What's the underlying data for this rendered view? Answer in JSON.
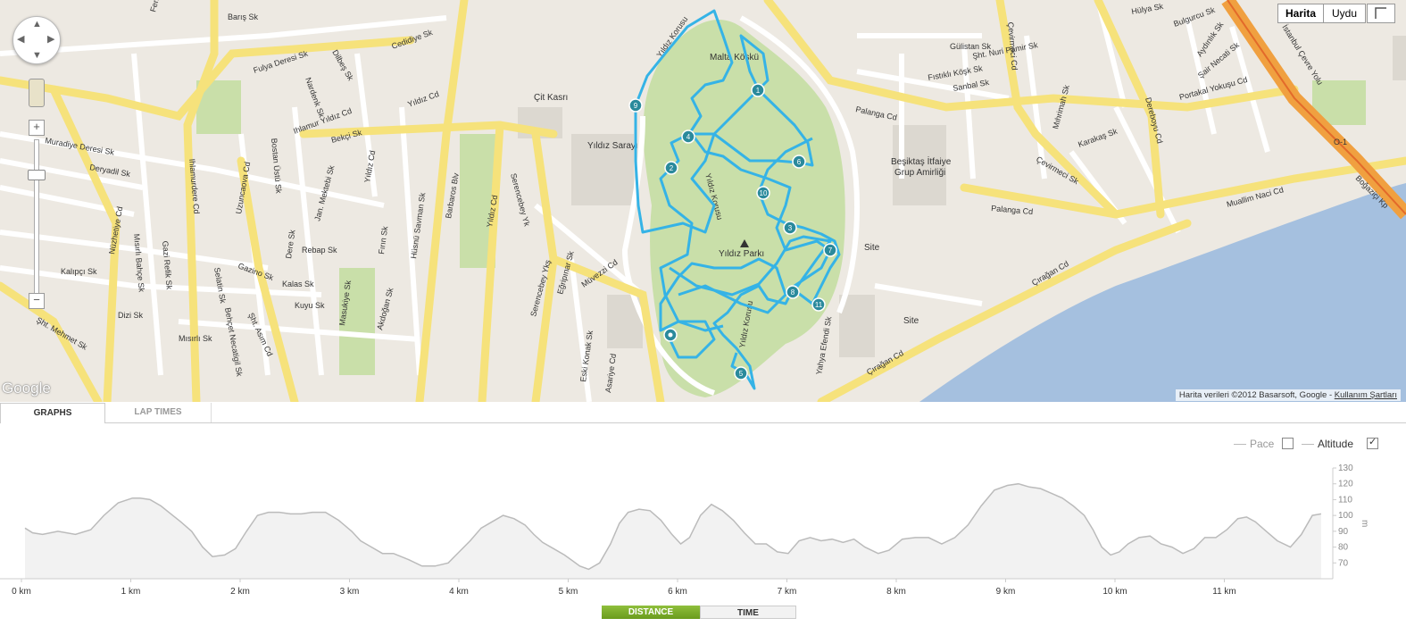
{
  "map": {
    "map_type_buttons": {
      "map": "Harita",
      "satellite": "Uydu"
    },
    "zoom": {
      "in": "+",
      "out": "−"
    },
    "park_name": "Yıldız Parkı",
    "pois": [
      "Malta Köşkü",
      "Çit Kasrı",
      "Yıldız Sarayı",
      "Beşiktaş İtfaiye",
      "Grup Amirliği",
      "Site",
      "Site"
    ],
    "street_labels": [
      "Fenet Cd",
      "Barış Sk",
      "Fulya Deresi Sk",
      "Dilbeş Sk",
      "Nardenk Sk",
      "Cedidiye Sk",
      "Ihlamur Yıldız Cd",
      "Yıldız Cd",
      "Barbaros Blv",
      "Yıldız Cd",
      "Serencebey Yk",
      "Muradiye Deresi Sk",
      "Deryadil Sk",
      "Nüzhetiye Cd",
      "Ihlamurdere Cd",
      "Uzuncaova Cd",
      "Bekçi Sk",
      "Yıldız Cd",
      "Rebap Sk",
      "Gazino Sk",
      "Kalas Sk",
      "Kuyu Sk",
      "Mısırlı Bahçe Sk",
      "Gazi Refik Sk",
      "Dizi Sk",
      "Mısırlı Sk",
      "Şht. Asım Cd",
      "Behçet Necatigil Sk",
      "Serencebey Ykş",
      "Eğripınar Sk",
      "Müvezzi Cd",
      "Eski Konak Sk",
      "Asariye Cd",
      "Yıldız Korusu",
      "Yıldız Korusu",
      "Yıldız Korusu",
      "Gülistan Sk",
      "Şht. Nuri Pamir Sk",
      "Fıstıklı Köşk Sk",
      "Sanbal Sk",
      "Palanga Cd",
      "Çevirmeci Cd",
      "Çevirmeci Sk",
      "Dereboyu Cd",
      "Portakal Yokuşu Cd",
      "İstanbul Çevre Yolu",
      "Boğaziçi Kp",
      "Muallim Naci Cd",
      "Palanga Cd",
      "Çırağan Cd",
      "Çırağan Cd",
      "Karakaş Sk",
      "Mıhrimah Sk",
      "Yahya Efendi Sk",
      "Hülya Sk",
      "Bulgurcu Sk",
      "Aydınlık Sk",
      "Şair Necati Sk",
      "Kalıpçı Sk",
      "Şht. Mehmet Sk",
      "Hüsnü Savman Sk",
      "Fırın Sk",
      "Akdoğan Sk",
      "Masukiye Sk",
      "Bostan Üstü Sk",
      "Jan. Mektebi Sk",
      "Dere Sk",
      "Selatin Sk",
      "O-1"
    ],
    "lap_markers": [
      "1",
      "2",
      "3",
      "4",
      "5",
      "6",
      "7",
      "8",
      "9",
      "10",
      "11"
    ],
    "logo": "Google",
    "attribution_prefix": "Harita verileri ©2012 Basarsoft, Google - ",
    "attribution_link": "Kullanım Şartları",
    "colors": {
      "route": "#35b3e6",
      "park": "#c9dfa9",
      "major_road": "#f6e27b",
      "water": "#a5c0df",
      "land": "#ede9e2"
    }
  },
  "tabs": {
    "graphs": "GRAPHS",
    "lap_times": "LAP TIMES"
  },
  "legend": {
    "pace": {
      "label": "Pace",
      "checked": false
    },
    "altitude": {
      "label": "Altitude",
      "checked": true
    }
  },
  "x_toggle": {
    "distance": "DISTANCE",
    "time": "TIME",
    "active": "distance"
  },
  "chart_data": {
    "type": "area",
    "xlabel": "",
    "ylabel": "m",
    "x_unit": "km",
    "xlim": [
      0,
      12.1
    ],
    "ylim": [
      60,
      130
    ],
    "x_ticks": [
      "0 km",
      "1 km",
      "2 km",
      "3 km",
      "4 km",
      "5 km",
      "6 km",
      "7 km",
      "8 km",
      "9 km",
      "10 km",
      "11 km"
    ],
    "y_ticks": [
      70,
      80,
      90,
      100,
      110,
      120,
      130
    ],
    "series": [
      {
        "name": "Altitude",
        "color": "#bbbbbb",
        "x": [
          0.0,
          0.07,
          0.16,
          0.3,
          0.46,
          0.6,
          0.72,
          0.85,
          0.98,
          1.05,
          1.14,
          1.24,
          1.33,
          1.42,
          1.52,
          1.62,
          1.71,
          1.82,
          1.92,
          2.02,
          2.12,
          2.22,
          2.32,
          2.42,
          2.52,
          2.62,
          2.74,
          2.86,
          2.98,
          3.06,
          3.16,
          3.26,
          3.36,
          3.5,
          3.62,
          3.74,
          3.86,
          3.96,
          4.06,
          4.16,
          4.26,
          4.36,
          4.46,
          4.56,
          4.64,
          4.72,
          4.82,
          4.92,
          5.0,
          5.06,
          5.14,
          5.24,
          5.34,
          5.42,
          5.5,
          5.6,
          5.7,
          5.8,
          5.9,
          5.98,
          6.06,
          6.16,
          6.26,
          6.36,
          6.46,
          6.56,
          6.66,
          6.76,
          6.86,
          6.96,
          7.06,
          7.16,
          7.26,
          7.36,
          7.46,
          7.56,
          7.66,
          7.78,
          7.88,
          8.0,
          8.12,
          8.24,
          8.36,
          8.48,
          8.6,
          8.72,
          8.84,
          8.96,
          9.06,
          9.16,
          9.26,
          9.36,
          9.46,
          9.56,
          9.66,
          9.74,
          9.82,
          9.9,
          9.98,
          10.06,
          10.16,
          10.26,
          10.36,
          10.46,
          10.56,
          10.66,
          10.76,
          10.86,
          10.96,
          11.06,
          11.14,
          11.22,
          11.32,
          11.42,
          11.54,
          11.64,
          11.74,
          11.82
        ],
        "values": [
          92,
          89,
          88,
          90,
          88,
          91,
          100,
          108,
          111,
          111,
          110,
          106,
          101,
          96,
          90,
          80,
          74,
          75,
          79,
          90,
          100,
          102,
          102,
          101,
          101,
          102,
          102,
          97,
          90,
          84,
          80,
          76,
          76,
          72,
          68,
          68,
          70,
          77,
          84,
          92,
          96,
          100,
          98,
          94,
          88,
          83,
          79,
          75,
          71,
          68,
          66,
          70,
          82,
          95,
          102,
          104,
          103,
          97,
          88,
          82,
          86,
          100,
          107,
          103,
          97,
          89,
          82,
          82,
          77,
          76,
          84,
          86,
          84,
          85,
          83,
          85,
          80,
          76,
          78,
          85,
          86,
          86,
          82,
          86,
          94,
          106,
          116,
          119,
          120,
          118,
          117,
          114,
          111,
          106,
          100,
          91,
          80,
          75,
          77,
          82,
          86,
          87,
          82,
          80,
          76,
          79,
          86,
          86,
          91,
          98,
          99,
          96,
          90,
          84,
          80,
          88,
          100,
          101
        ]
      }
    ]
  }
}
